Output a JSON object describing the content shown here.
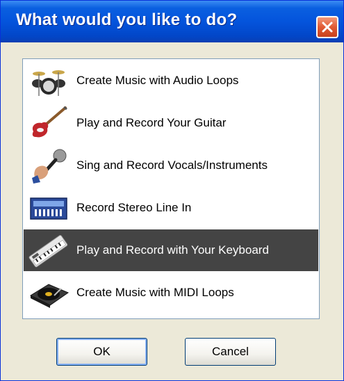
{
  "dialog": {
    "title": "What would you like to do?",
    "close_icon": "close-icon"
  },
  "options": [
    {
      "label": "Create Music with Audio Loops",
      "icon": "drum-kit-icon",
      "selected": false
    },
    {
      "label": "Play and Record Your Guitar",
      "icon": "electric-guitar-icon",
      "selected": false
    },
    {
      "label": "Sing and Record Vocals/Instruments",
      "icon": "microphone-icon",
      "selected": false
    },
    {
      "label": "Record Stereo Line In",
      "icon": "mixer-icon",
      "selected": false
    },
    {
      "label": "Play and Record with Your Keyboard",
      "icon": "keyboard-icon",
      "selected": true
    },
    {
      "label": "Create Music with MIDI Loops",
      "icon": "turntable-icon",
      "selected": false
    }
  ],
  "buttons": {
    "ok_label": "OK",
    "cancel_label": "Cancel"
  },
  "colors": {
    "titlebar": "#0454dc",
    "selection": "#444444",
    "window_bg": "#ece9d8"
  }
}
